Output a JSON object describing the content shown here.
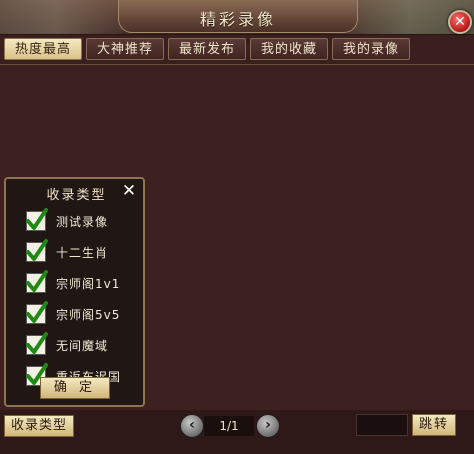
{
  "window": {
    "title": "精彩录像",
    "close_icon": "close-icon"
  },
  "tabs": [
    {
      "label": "热度最高",
      "active": true
    },
    {
      "label": "大神推荐",
      "active": false
    },
    {
      "label": "最新发布",
      "active": false
    },
    {
      "label": "我的收藏",
      "active": false
    },
    {
      "label": "我的录像",
      "active": false
    }
  ],
  "filter_panel": {
    "title": "收录类型",
    "options": [
      {
        "label": "测试录像",
        "checked": true
      },
      {
        "label": "十二生肖",
        "checked": true
      },
      {
        "label": "宗师阁1v1",
        "checked": true
      },
      {
        "label": "宗师阁5v5",
        "checked": true
      },
      {
        "label": "无间魔域",
        "checked": true
      },
      {
        "label": "重返车迟国",
        "checked": true
      }
    ],
    "confirm_label": "确 定"
  },
  "bottom": {
    "type_button_label": "收录类型",
    "page_text": "1/1",
    "jump_button_label": "跳转",
    "jump_value": ""
  },
  "colors": {
    "background": "#3d2120",
    "accent_gold": "#d9c28c",
    "check_green": "#1f8a13"
  }
}
